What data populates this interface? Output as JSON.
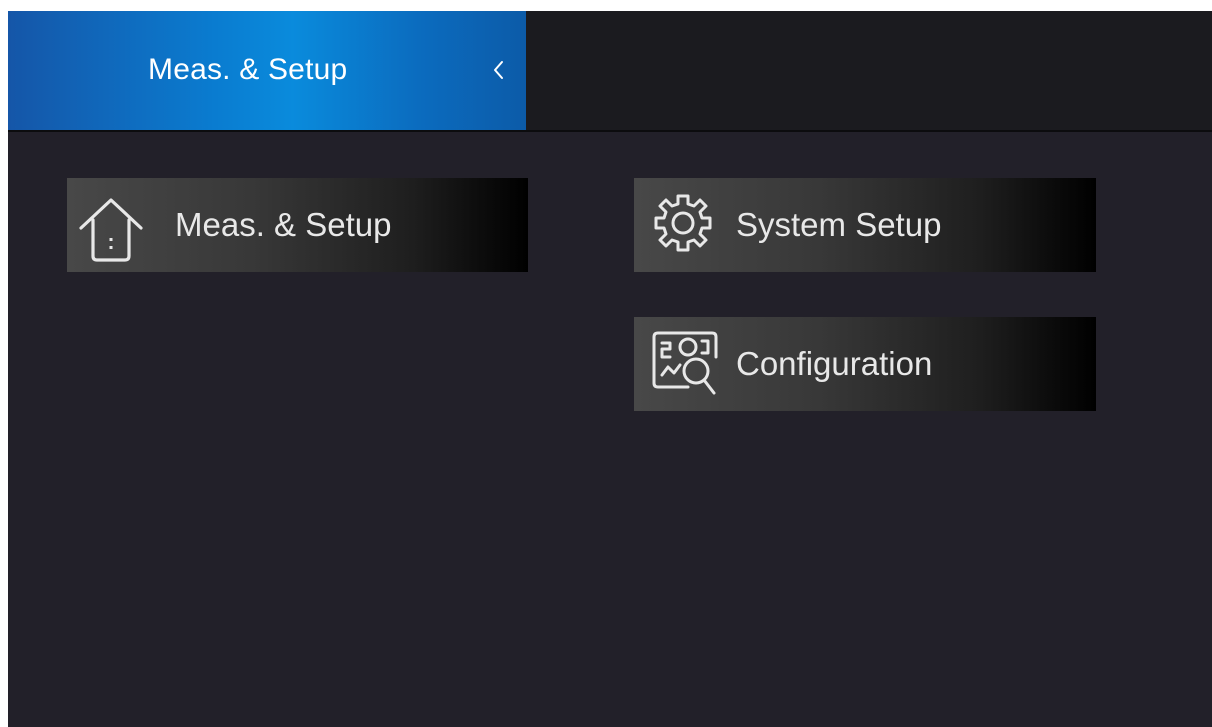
{
  "header": {
    "title": "Meas. & Setup",
    "back_icon": "chevron-left-icon",
    "tab_gradient": [
      "#1556a8",
      "#0a8bdc",
      "#0c5ba8"
    ]
  },
  "menu": {
    "items": [
      {
        "label": "Meas. & Setup",
        "icon": "home-icon"
      },
      {
        "label": "System Setup",
        "icon": "gear-icon"
      },
      {
        "label": "Configuration",
        "icon": "configuration-search-icon"
      }
    ]
  },
  "colors": {
    "background": "#222029",
    "topbar": "#1b1b1f",
    "button_text": "#e8e8e8"
  }
}
